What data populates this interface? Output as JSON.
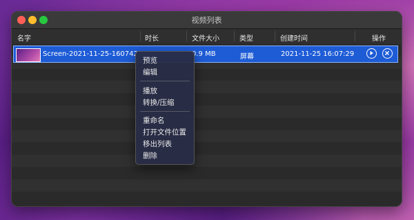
{
  "window": {
    "title": "视频列表"
  },
  "columns": [
    {
      "key": "name",
      "label": "名字"
    },
    {
      "key": "duration",
      "label": "时长"
    },
    {
      "key": "size",
      "label": "文件大小"
    },
    {
      "key": "type",
      "label": "类型"
    },
    {
      "key": "created",
      "label": "创建时间"
    },
    {
      "key": "actions",
      "label": "操作"
    }
  ],
  "selected_row": {
    "name": "Screen-2021-11-25-160742",
    "size": "0.9 MB",
    "type": "屏幕",
    "created": "2021-11-25 16:07:29"
  },
  "icons": {
    "play": "play-icon",
    "convert": "convert-icon"
  },
  "context_menu": {
    "items": [
      {
        "label": "预览"
      },
      {
        "label": "编辑"
      },
      {
        "label": "播放"
      },
      {
        "label": "转换/压缩"
      },
      {
        "label": "重命名"
      },
      {
        "label": "打开文件位置"
      },
      {
        "label": "移出列表"
      },
      {
        "label": "删除"
      }
    ]
  },
  "colors": {
    "selection": "#1e5cd6",
    "window_bg": "#2a2a2a",
    "menu_bg": "#282c46"
  }
}
